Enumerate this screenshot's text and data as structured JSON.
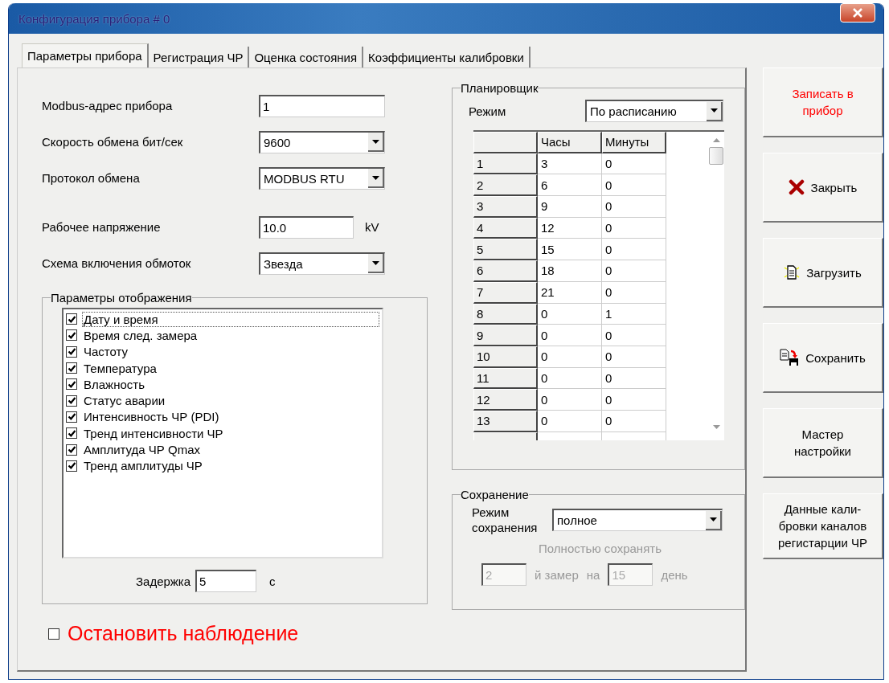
{
  "window": {
    "title": "Конфигурация прибора # 0"
  },
  "tabs": [
    {
      "label": "Параметры прибора",
      "selected": true
    },
    {
      "label": "Регистрация ЧР",
      "selected": false
    },
    {
      "label": "Оценка состояния",
      "selected": false
    },
    {
      "label": "Коэффициенты калибровки",
      "selected": false
    }
  ],
  "device_fields": [
    {
      "label": "Modbus-адрес прибора",
      "kind": "text",
      "value": "1"
    },
    {
      "label": "Скорость обмена бит/сек",
      "kind": "select",
      "value": "9600"
    },
    {
      "label": "Протокол обмена",
      "kind": "select",
      "value": "MODBUS RTU"
    },
    {
      "label": "Рабочее напряжение",
      "kind": "text",
      "value": "10.0",
      "unit": "kV"
    },
    {
      "label": "Схема включения обмоток",
      "kind": "select",
      "value": "Звезда"
    }
  ],
  "display_group": {
    "title": "Параметры отображения",
    "items": [
      {
        "label": "Дату и время",
        "checked": true,
        "focused": true
      },
      {
        "label": "Время след. замера",
        "checked": true,
        "focused": false
      },
      {
        "label": "Частоту",
        "checked": true,
        "focused": false
      },
      {
        "label": "Температура",
        "checked": true,
        "focused": false
      },
      {
        "label": "Влажность",
        "checked": true,
        "focused": false
      },
      {
        "label": "Статус аварии",
        "checked": true,
        "focused": false
      },
      {
        "label": "Интенсивность ЧР (PDI)",
        "checked": true,
        "focused": false
      },
      {
        "label": "Тренд интенсивности ЧР",
        "checked": true,
        "focused": false
      },
      {
        "label": "Амплитуда ЧР Qmax",
        "checked": true,
        "focused": false
      },
      {
        "label": "Тренд амплитуды ЧР",
        "checked": true,
        "focused": false
      }
    ],
    "delay": {
      "label": "Задержка",
      "value": "5",
      "unit": "с"
    }
  },
  "stop_monitoring": {
    "label": "Остановить наблюдение",
    "checked": false
  },
  "scheduler": {
    "title": "Планировщик",
    "mode_label": "Режим",
    "mode_value": "По расписанию",
    "columns": [
      "Часы",
      "Минуты"
    ],
    "rows": [
      {
        "index": "1",
        "cells": [
          "3",
          "0"
        ]
      },
      {
        "index": "2",
        "cells": [
          "6",
          "0"
        ]
      },
      {
        "index": "3",
        "cells": [
          "9",
          "0"
        ]
      },
      {
        "index": "4",
        "cells": [
          "12",
          "0"
        ]
      },
      {
        "index": "5",
        "cells": [
          "15",
          "0"
        ]
      },
      {
        "index": "6",
        "cells": [
          "18",
          "0"
        ]
      },
      {
        "index": "7",
        "cells": [
          "21",
          "0"
        ]
      },
      {
        "index": "8",
        "cells": [
          "0",
          "1"
        ]
      },
      {
        "index": "9",
        "cells": [
          "0",
          "0"
        ]
      },
      {
        "index": "10",
        "cells": [
          "0",
          "0"
        ]
      },
      {
        "index": "11",
        "cells": [
          "0",
          "0"
        ]
      },
      {
        "index": "12",
        "cells": [
          "0",
          "0"
        ]
      },
      {
        "index": "13",
        "cells": [
          "0",
          "0"
        ]
      }
    ]
  },
  "saving": {
    "title": "Сохранение",
    "mode_label": "Режим сохранения",
    "mode_value": "полное",
    "disabled": true,
    "hint": "Полностью сохранять",
    "measure_value": "2",
    "measure_label": "й замер",
    "on_label": "на",
    "day_value": "15",
    "day_label": "день"
  },
  "buttons": [
    {
      "label": "Записать в прибор",
      "emphasis": true
    },
    {
      "label": "Закрыть",
      "kind": "close",
      "emphasis": false
    },
    {
      "label": "Загрузить",
      "kind": "load",
      "emphasis": false
    },
    {
      "label": "Сохранить",
      "kind": "save",
      "emphasis": false
    },
    {
      "label": "Мастер настройки",
      "emphasis": false
    },
    {
      "label": "Данные кали-\nбровки каналов\nрегистарции ЧР",
      "emphasis": false
    }
  ]
}
